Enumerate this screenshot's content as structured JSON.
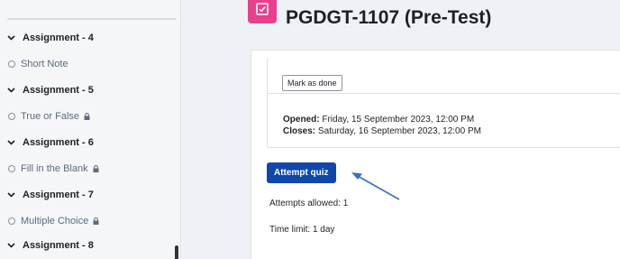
{
  "sidebar": {
    "items": [
      {
        "type": "section",
        "label": "Assignment - 4"
      },
      {
        "type": "activity",
        "label": "Short Note",
        "locked": false
      },
      {
        "type": "section",
        "label": "Assignment - 5"
      },
      {
        "type": "activity",
        "label": "True or False",
        "locked": true
      },
      {
        "type": "section",
        "label": "Assignment - 6"
      },
      {
        "type": "activity",
        "label": "Fill in the Blank",
        "locked": true
      },
      {
        "type": "section",
        "label": "Assignment - 7"
      },
      {
        "type": "activity",
        "label": "Multiple Choice",
        "locked": true
      },
      {
        "type": "section",
        "label": "Assignment - 8"
      }
    ]
  },
  "header": {
    "title": "PGDGT-1107 (Pre-Test)",
    "icon": "quiz-icon",
    "icon_color": "#e8408a"
  },
  "completion": {
    "mark_done_label": "Mark as done"
  },
  "dates": {
    "opened_label": "Opened:",
    "opened_value": "Friday, 15 September 2023, 12:00 PM",
    "closes_label": "Closes:",
    "closes_value": "Saturday, 16 September 2023, 12:00 PM"
  },
  "quiz": {
    "attempt_button": "Attempt quiz",
    "attempts_allowed": "Attempts allowed: 1",
    "time_limit": "Time limit: 1 day",
    "button_color": "#0f47ad"
  },
  "annotation": {
    "arrow_color": "#3b6fc4"
  }
}
